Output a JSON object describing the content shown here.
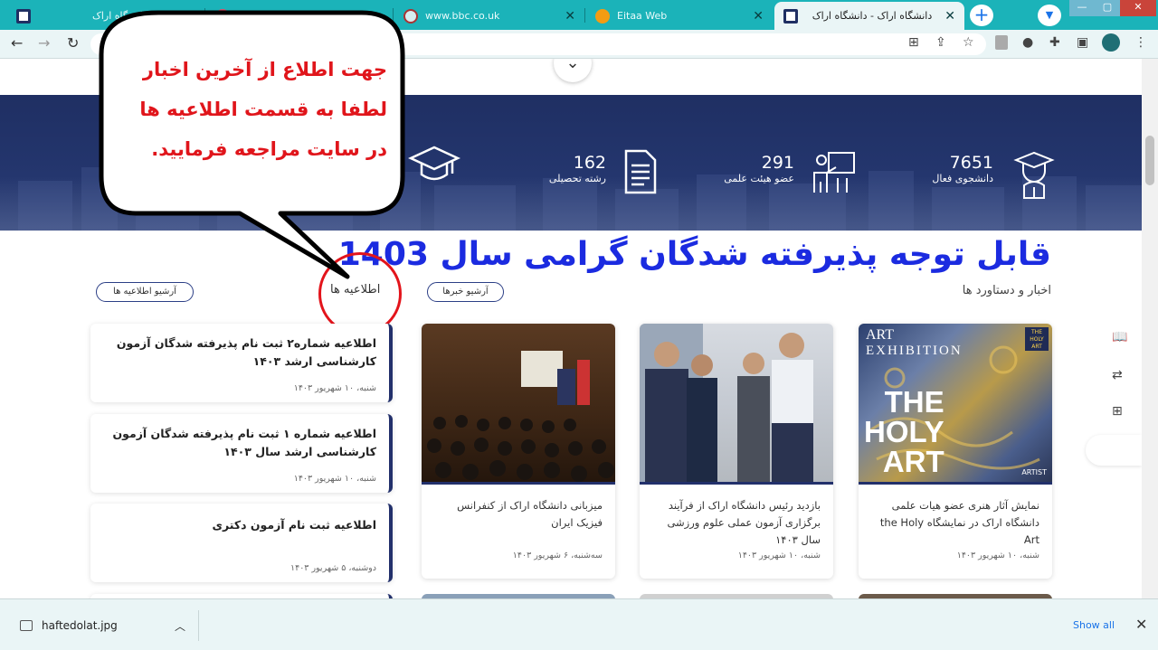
{
  "browser": {
    "tabs": [
      {
        "title": "دانشگاه اراک",
        "active": false
      },
      {
        "title": "",
        "active": false
      },
      {
        "title": "www.bbc.co.uk",
        "active": false
      },
      {
        "title": "Eitaa Web",
        "active": false
      },
      {
        "title": "دانشگاه اراک - دانشگاه اراک",
        "active": true
      }
    ],
    "accent": "#1bb3b9"
  },
  "page": {
    "stats": [
      {
        "value": "7651",
        "label": "دانشجوی فعال",
        "icon": "graduate-icon"
      },
      {
        "value": "291",
        "label": "عضو هیئت علمی",
        "icon": "teacher-board-icon"
      },
      {
        "value": "162",
        "label": "رشته تحصیلی",
        "icon": "document-icon"
      }
    ],
    "headline": "قابل توجه پذیرفته شدگان گرامی سال 1403",
    "news_section_title": "اخبار و دستاورد ها",
    "news_archive_label": "آرشیو خبرها",
    "notices_title": "اطلاعیه ها",
    "notices_archive_label": "آرشیو اطلاعیه ها",
    "notices": [
      {
        "title": "اطلاعیه شماره۲ ثبت نام پذیرفته شدگان آزمون کارشناسی ارشد ۱۴۰۳",
        "date": "شنبه، ۱۰ شهریور ۱۴۰۳"
      },
      {
        "title": "اطلاعیه شماره ۱ ثبت نام پذیرفته شدگان آزمون کارشناسی ارشد سال ۱۴۰۳",
        "date": "شنبه، ۱۰ شهریور ۱۴۰۳"
      },
      {
        "title": "اطلاعیه ثبت نام آزمون دکتری",
        "date": "دوشنبه، ۵ شهریور ۱۴۰۳"
      }
    ],
    "news": [
      {
        "title": "نمایش آثار هنری عضو هیات علمی دانشگاه اراک در نمایشگاه the Holy Art",
        "date": "شنبه، ۱۰ شهریور ۱۴۰۳"
      },
      {
        "title": "بازدید رئیس دانشگاه اراک از فرآیند برگزاری آزمون عملی علوم ورزشی سال ۱۴۰۳",
        "date": "شنبه، ۱۰ شهریور ۱۴۰۳"
      },
      {
        "title": "میزبانی دانشگاه اراک از کنفرانس فیزیک ایران",
        "date": "سه‌شنبه، ۶ شهریور ۱۴۰۳"
      }
    ],
    "poster_text": {
      "line1": "ART",
      "line2": "EXHIBITION",
      "badge": "THE HOLY ART",
      "big1": "THE",
      "big2": "HOLY",
      "big3": "ART",
      "corner": "ARTIST"
    }
  },
  "callout": {
    "lines": [
      "جهت اطلاع از آخرین اخبار",
      "لطفا به قسمت اطلاعیه ها",
      "در سایت مراجعه فرمایید."
    ],
    "color": "#e0151b"
  },
  "downloads": {
    "file": "haftedolat.jpg",
    "show_all": "Show all"
  }
}
